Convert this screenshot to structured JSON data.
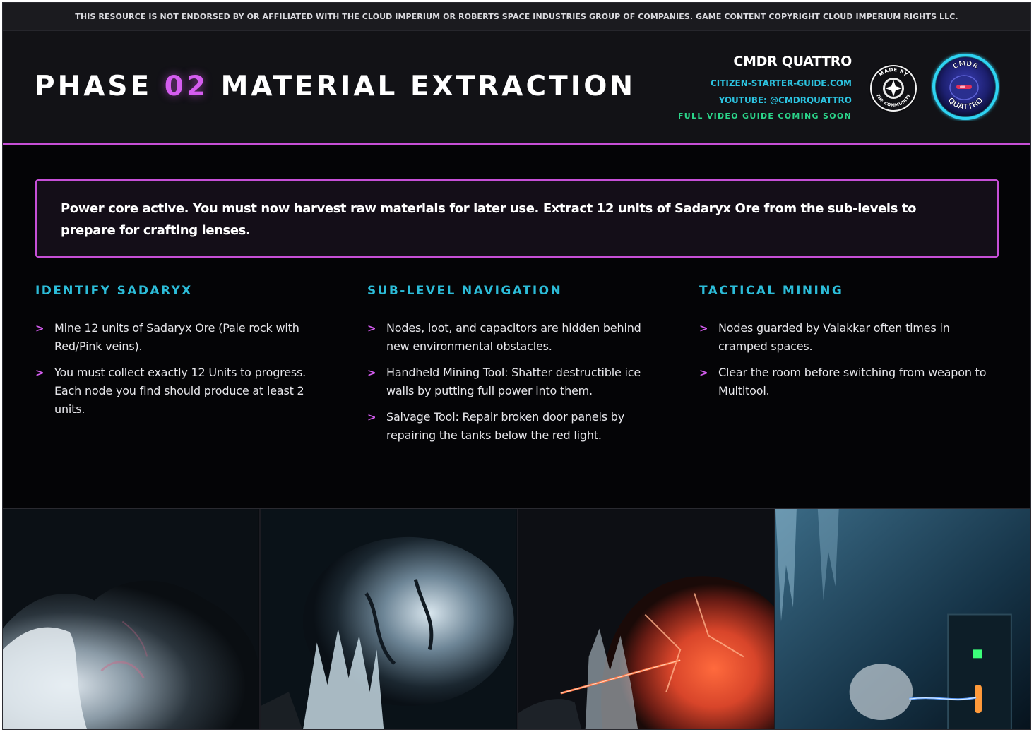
{
  "disclaimer": "THIS RESOURCE IS NOT ENDORSED BY OR AFFILIATED WITH THE CLOUD IMPERIUM OR ROBERTS SPACE INDUSTRIES GROUP OF COMPANIES. GAME CONTENT COPYRIGHT CLOUD IMPERIUM RIGHTS LLC.",
  "header": {
    "title_pre": "PHASE ",
    "title_accent": "02",
    "title_post": " MATERIAL EXTRACTION",
    "brand_name": "CMDR QUATTRO",
    "website": "CITIZEN-STARTER-GUIDE.COM",
    "youtube": "YOUTUBE: @CMDRQUATTRO",
    "coming_soon": "FULL VIDEO GUIDE COMING SOON",
    "badge_community_top": "MADE BY",
    "badge_community_bottom": "THE COMMUNITY",
    "badge_cmdr_top": "CMDR",
    "badge_cmdr_bottom": "QUATTRO"
  },
  "callout": "Power core active. You must now harvest raw materials for later use. Extract 12 units of Sadaryx Ore from the sub-levels to prepare for crafting lenses.",
  "sections": [
    {
      "heading": "IDENTIFY SADARYX",
      "items": [
        "Mine 12 units of Sadaryx Ore (Pale rock with Red/Pink veins).",
        "You must collect exactly 12 Units to progress. Each node you find should produce at least 2 units."
      ]
    },
    {
      "heading": "SUB-LEVEL NAVIGATION",
      "items": [
        "Nodes, loot, and capacitors are hidden behind new environmental obstacles.",
        "Handheld Mining Tool: Shatter destructible ice walls by putting full power into them.",
        "Salvage Tool: Repair broken door panels by repairing the tanks below the red light."
      ]
    },
    {
      "heading": "TACTICAL MINING",
      "items": [
        "Nodes guarded by Valakkar often times in cramped spaces.",
        "Clear the room before switching from weapon to Multitool."
      ]
    }
  ],
  "bullet_glyph": ">",
  "colors": {
    "accent_magenta": "#d55df0",
    "accent_cyan": "#2cbcd8",
    "accent_green": "#2bd58a",
    "background": "#040406"
  }
}
